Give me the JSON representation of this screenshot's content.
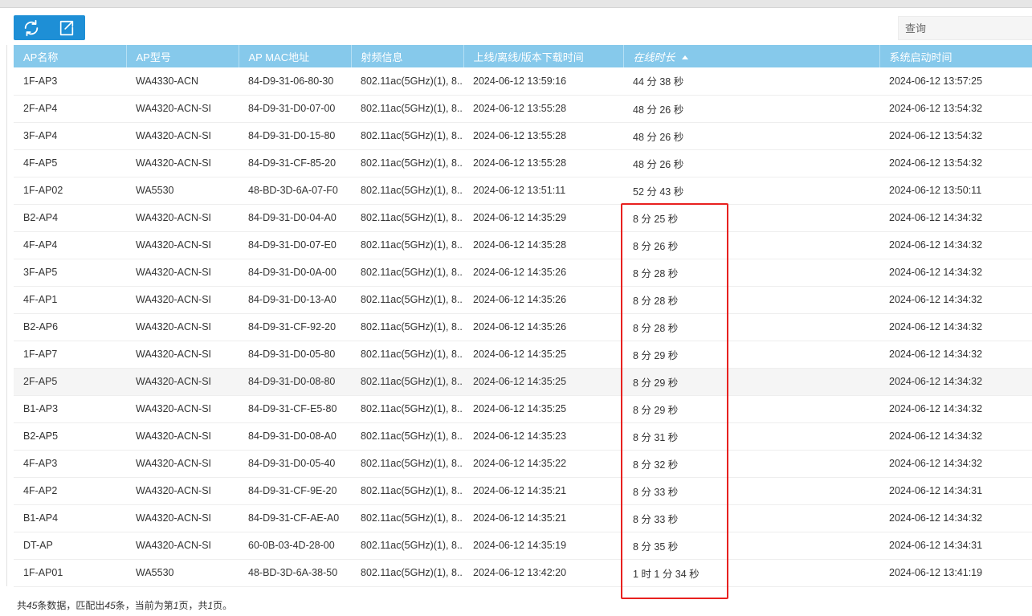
{
  "search": {
    "placeholder": "查询"
  },
  "toolbar": {
    "refresh_icon": "refresh-icon",
    "export_icon": "export-icon"
  },
  "table": {
    "columns": [
      "AP名称",
      "AP型号",
      "AP MAC地址",
      "射频信息",
      "上线/离线/版本下载时间",
      "在线时长",
      "系统启动时间"
    ],
    "sorted_column": "在线时长",
    "sort_direction": "ascending",
    "rows": [
      [
        "1F-AP3",
        "WA4330-ACN",
        "84-D9-31-06-80-30",
        "802.11ac(5GHz)(1), 8...",
        "2024-06-12 13:59:16",
        "44 分 38 秒",
        "2024-06-12 13:57:25"
      ],
      [
        "2F-AP4",
        "WA4320-ACN-SI",
        "84-D9-31-D0-07-00",
        "802.11ac(5GHz)(1), 8...",
        "2024-06-12 13:55:28",
        "48 分 26 秒",
        "2024-06-12 13:54:32"
      ],
      [
        "3F-AP4",
        "WA4320-ACN-SI",
        "84-D9-31-D0-15-80",
        "802.11ac(5GHz)(1), 8...",
        "2024-06-12 13:55:28",
        "48 分 26 秒",
        "2024-06-12 13:54:32"
      ],
      [
        "4F-AP5",
        "WA4320-ACN-SI",
        "84-D9-31-CF-85-20",
        "802.11ac(5GHz)(1), 8...",
        "2024-06-12 13:55:28",
        "48 分 26 秒",
        "2024-06-12 13:54:32"
      ],
      [
        "1F-AP02",
        "WA5530",
        "48-BD-3D-6A-07-F0",
        "802.11ac(5GHz)(1), 8...",
        "2024-06-12 13:51:11",
        "52 分 43 秒",
        "2024-06-12 13:50:11"
      ],
      [
        "B2-AP4",
        "WA4320-ACN-SI",
        "84-D9-31-D0-04-A0",
        "802.11ac(5GHz)(1), 8...",
        "2024-06-12 14:35:29",
        "8 分 25 秒",
        "2024-06-12 14:34:32"
      ],
      [
        "4F-AP4",
        "WA4320-ACN-SI",
        "84-D9-31-D0-07-E0",
        "802.11ac(5GHz)(1), 8...",
        "2024-06-12 14:35:28",
        "8 分 26 秒",
        "2024-06-12 14:34:32"
      ],
      [
        "3F-AP5",
        "WA4320-ACN-SI",
        "84-D9-31-D0-0A-00",
        "802.11ac(5GHz)(1), 8...",
        "2024-06-12 14:35:26",
        "8 分 28 秒",
        "2024-06-12 14:34:32"
      ],
      [
        "4F-AP1",
        "WA4320-ACN-SI",
        "84-D9-31-D0-13-A0",
        "802.11ac(5GHz)(1), 8...",
        "2024-06-12 14:35:26",
        "8 分 28 秒",
        "2024-06-12 14:34:32"
      ],
      [
        "B2-AP6",
        "WA4320-ACN-SI",
        "84-D9-31-CF-92-20",
        "802.11ac(5GHz)(1), 8...",
        "2024-06-12 14:35:26",
        "8 分 28 秒",
        "2024-06-12 14:34:32"
      ],
      [
        "1F-AP7",
        "WA4320-ACN-SI",
        "84-D9-31-D0-05-80",
        "802.11ac(5GHz)(1), 8...",
        "2024-06-12 14:35:25",
        "8 分 29 秒",
        "2024-06-12 14:34:32"
      ],
      [
        "2F-AP5",
        "WA4320-ACN-SI",
        "84-D9-31-D0-08-80",
        "802.11ac(5GHz)(1), 8...",
        "2024-06-12 14:35:25",
        "8 分 29 秒",
        "2024-06-12 14:34:32"
      ],
      [
        "B1-AP3",
        "WA4320-ACN-SI",
        "84-D9-31-CF-E5-80",
        "802.11ac(5GHz)(1), 8...",
        "2024-06-12 14:35:25",
        "8 分 29 秒",
        "2024-06-12 14:34:32"
      ],
      [
        "B2-AP5",
        "WA4320-ACN-SI",
        "84-D9-31-D0-08-A0",
        "802.11ac(5GHz)(1), 8...",
        "2024-06-12 14:35:23",
        "8 分 31 秒",
        "2024-06-12 14:34:32"
      ],
      [
        "4F-AP3",
        "WA4320-ACN-SI",
        "84-D9-31-D0-05-40",
        "802.11ac(5GHz)(1), 8...",
        "2024-06-12 14:35:22",
        "8 分 32 秒",
        "2024-06-12 14:34:32"
      ],
      [
        "4F-AP2",
        "WA4320-ACN-SI",
        "84-D9-31-CF-9E-20",
        "802.11ac(5GHz)(1), 8...",
        "2024-06-12 14:35:21",
        "8 分 33 秒",
        "2024-06-12 14:34:31"
      ],
      [
        "B1-AP4",
        "WA4320-ACN-SI",
        "84-D9-31-CF-AE-A0",
        "802.11ac(5GHz)(1), 8...",
        "2024-06-12 14:35:21",
        "8 分 33 秒",
        "2024-06-12 14:34:32"
      ],
      [
        "DT-AP",
        "WA4320-ACN-SI",
        "60-0B-03-4D-28-00",
        "802.11ac(5GHz)(1), 8...",
        "2024-06-12 14:35:19",
        "8 分 35 秒",
        "2024-06-12 14:34:31"
      ],
      [
        "1F-AP01",
        "WA5530",
        "48-BD-3D-6A-38-50",
        "802.11ac(5GHz)(1), 8...",
        "2024-06-12 13:42:20",
        "1 时 1 分 34 秒",
        "2024-06-12 13:41:19"
      ]
    ],
    "hovered_row": "2F-AP5"
  },
  "footer": {
    "prefix": "共",
    "total": "45",
    "mid1": "条数据，匹配出",
    "matched": "45",
    "mid2": "条，当前为第",
    "page": "1",
    "mid3": "页，共",
    "pages": "1",
    "suffix": "页。"
  },
  "colors": {
    "header_bg": "#86c9eb",
    "toolbar_bg": "#1e8fd6",
    "annotation_red": "#e8211f"
  }
}
